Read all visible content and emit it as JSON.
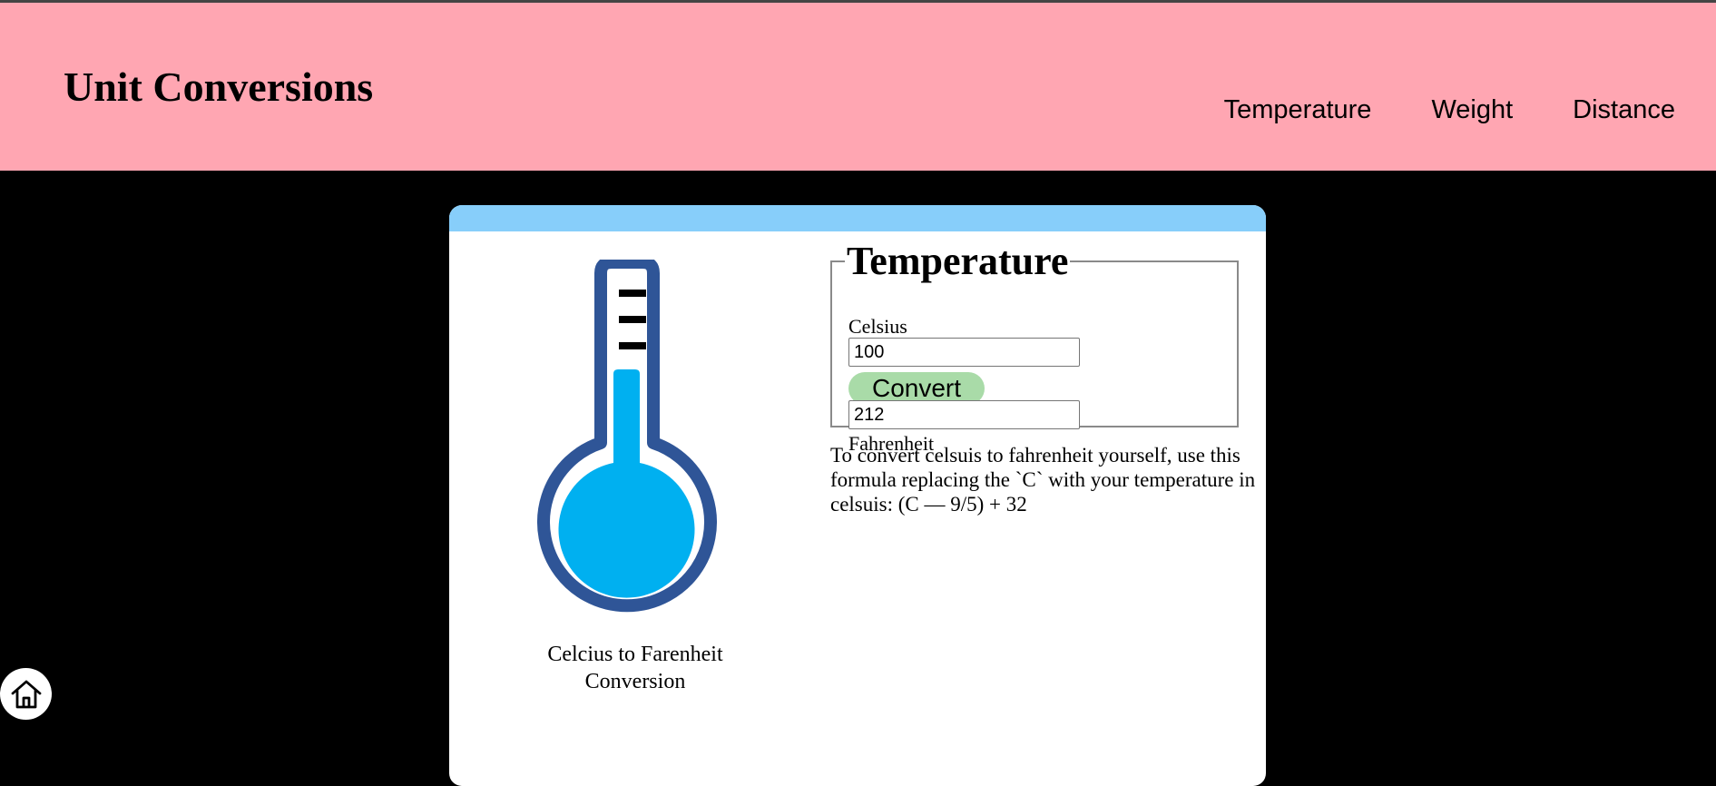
{
  "header": {
    "title": "Unit Conversions",
    "nav": [
      "Temperature",
      "Weight",
      "Distance"
    ]
  },
  "card": {
    "illustration": {
      "icon": "thermometer-icon",
      "caption_line1": "Celcius to Farenheit",
      "caption_line2": "Conversion"
    },
    "form": {
      "legend": "Temperature",
      "input_label": "Celsius",
      "input_value": "100",
      "button_label": "Convert",
      "output_value": "212",
      "output_label": "Fahrenheit"
    },
    "formula_text": "To convert celsuis to fahrenheit yourself, use this formula replacing the `C` with your temperature in celsuis: (C — 9/5) + 32"
  },
  "home_button": {
    "icon": "home-icon"
  },
  "colors": {
    "header_bg": "#ffa6b2",
    "card_bar": "#87cefa",
    "button_bg": "#a9dba8",
    "thermometer_outline": "#2f5597",
    "thermometer_liquid": "#00b0f0"
  }
}
